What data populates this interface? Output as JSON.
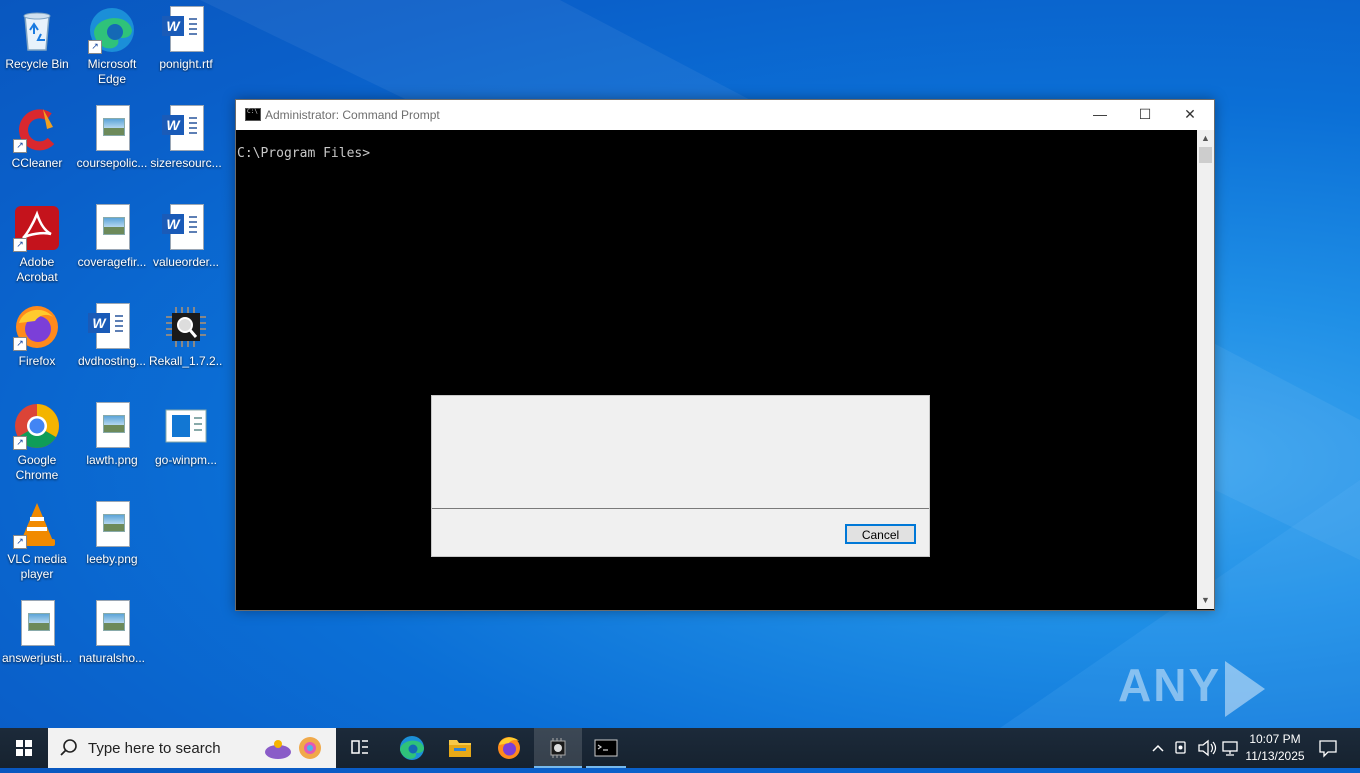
{
  "desktop": {
    "icons": [
      {
        "label": "Recycle Bin",
        "icon": "recycle-bin-icon"
      },
      {
        "label": "Microsoft Edge",
        "icon": "edge-icon"
      },
      {
        "label": "ponight.rtf",
        "icon": "word-document-icon"
      },
      {
        "label": "CCleaner",
        "icon": "ccleaner-icon"
      },
      {
        "label": "coursepolic...",
        "icon": "image-file-icon"
      },
      {
        "label": "sizeresourc...",
        "icon": "word-document-icon"
      },
      {
        "label": "Adobe Acrobat",
        "icon": "acrobat-icon"
      },
      {
        "label": "coveragefir...",
        "icon": "image-file-icon"
      },
      {
        "label": "valueorder...",
        "icon": "word-document-icon"
      },
      {
        "label": "Firefox",
        "icon": "firefox-icon"
      },
      {
        "label": "dvdhosting...",
        "icon": "word-document-icon"
      },
      {
        "label": "Rekall_1.7.2...",
        "icon": "rekall-icon"
      },
      {
        "label": "Google Chrome",
        "icon": "chrome-icon"
      },
      {
        "label": "lawth.png",
        "icon": "image-file-icon"
      },
      {
        "label": "go-winpm...",
        "icon": "installer-icon"
      },
      {
        "label": "VLC media player",
        "icon": "vlc-icon"
      },
      {
        "label": "leeby.png",
        "icon": "image-file-icon"
      },
      {
        "label": "answerjusti...",
        "icon": "image-file-icon"
      },
      {
        "label": "naturalsho...",
        "icon": "image-file-icon"
      }
    ]
  },
  "cmd": {
    "title": "Administrator: Command Prompt",
    "prompt": "C:\\Program Files>",
    "minimize": "—",
    "maximize": "☐",
    "close": "✕"
  },
  "dialog": {
    "cancel_label": "Cancel"
  },
  "watermark": {
    "left": "ANY",
    "right": "RUN"
  },
  "taskbar": {
    "search_placeholder": "Type here to search",
    "apps": [
      "task-view",
      "edge",
      "file-explorer",
      "firefox",
      "rekall",
      "command-prompt"
    ],
    "time": "10:07 PM",
    "date": "11/13/2025"
  },
  "colors": {
    "accent": "#0078d7",
    "taskbar": "#1c2a3a"
  }
}
